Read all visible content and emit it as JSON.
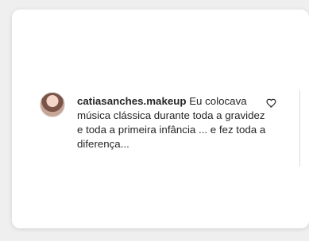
{
  "comment": {
    "username": "catiasanches.makeup",
    "text": "Eu colocava música clássica durante toda a gravidez e toda a primeira infância ... e fez toda a diferença..."
  },
  "icons": {
    "avatar": "profile-photo",
    "like": "heart-outline-icon"
  },
  "colors": {
    "background": "#efefef",
    "card": "#ffffff",
    "text": "#262626",
    "divider": "#dbdbdb"
  }
}
